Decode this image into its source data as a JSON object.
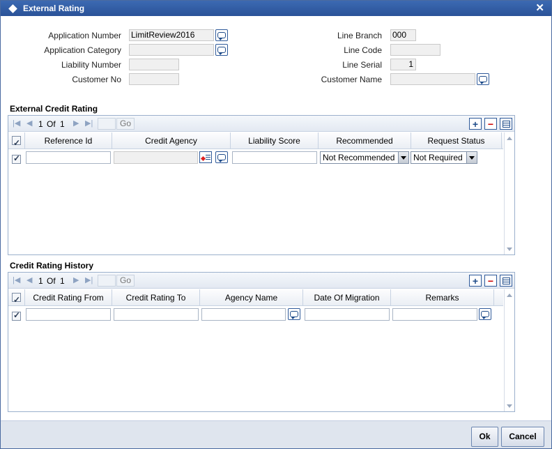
{
  "window": {
    "title": "External Rating"
  },
  "header": {
    "application_number_label": "Application Number",
    "application_number_value": "LimitReview2016",
    "application_category_label": "Application Category",
    "application_category_value": "",
    "liability_number_label": "Liability Number",
    "liability_number_value": "",
    "customer_no_label": "Customer No",
    "customer_no_value": "",
    "line_branch_label": "Line Branch",
    "line_branch_value": "000",
    "line_code_label": "Line Code",
    "line_code_value": "",
    "line_serial_label": "Line Serial",
    "line_serial_value": "1",
    "customer_name_label": "Customer Name",
    "customer_name_value": ""
  },
  "external_credit_rating": {
    "title": "External Credit Rating",
    "pager": {
      "current": "1",
      "of_label": "Of",
      "total": "1",
      "go_label": "Go"
    },
    "columns": [
      "Reference Id",
      "Credit Agency",
      "Liability Score",
      "Recommended",
      "Request Status"
    ],
    "row": {
      "reference_id": "",
      "credit_agency": "",
      "liability_score": "",
      "recommended": "Not Recommended",
      "request_status": "Not Required"
    }
  },
  "credit_rating_history": {
    "title": "Credit Rating History",
    "pager": {
      "current": "1",
      "of_label": "Of",
      "total": "1",
      "go_label": "Go"
    },
    "columns": [
      "Credit Rating From",
      "Credit Rating To",
      "Agency Name",
      "Date Of Migration",
      "Remarks"
    ],
    "row": {
      "credit_rating_from": "",
      "credit_rating_to": "",
      "agency_name": "",
      "date_of_migration": "",
      "remarks": ""
    }
  },
  "footer": {
    "ok_label": "Ok",
    "cancel_label": "Cancel"
  }
}
